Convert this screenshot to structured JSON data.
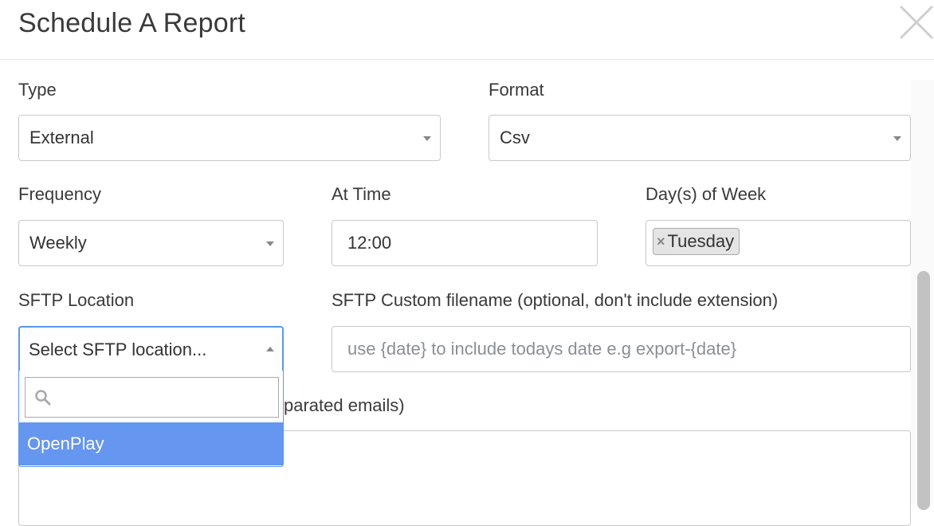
{
  "dialog": {
    "title": "Schedule A Report"
  },
  "type": {
    "label": "Type",
    "value": "External"
  },
  "format": {
    "label": "Format",
    "value": "Csv"
  },
  "frequency": {
    "label": "Frequency",
    "value": "Weekly"
  },
  "at_time": {
    "label": "At Time",
    "value": "12:00"
  },
  "days_of_week": {
    "label": "Day(s) of Week",
    "selected": [
      "Tuesday"
    ],
    "remove_symbol": "×"
  },
  "sftp_location": {
    "label": "SFTP Location",
    "placeholder": "Select SFTP location...",
    "search_value": "",
    "options": [
      "OpenPlay"
    ]
  },
  "sftp_filename": {
    "label": "SFTP Custom filename (optional, don't include extension)",
    "placeholder": "use {date} to include todays date e.g export-{date}"
  },
  "emails": {
    "label_visible_part": "parated emails)"
  },
  "icons": {
    "close": "close-icon",
    "search": "search-icon",
    "dropdown": "chevron-down-icon"
  },
  "colors": {
    "highlight": "#6596f0",
    "focus_border": "#5897fb",
    "tag_bg": "#e4e4e4"
  }
}
